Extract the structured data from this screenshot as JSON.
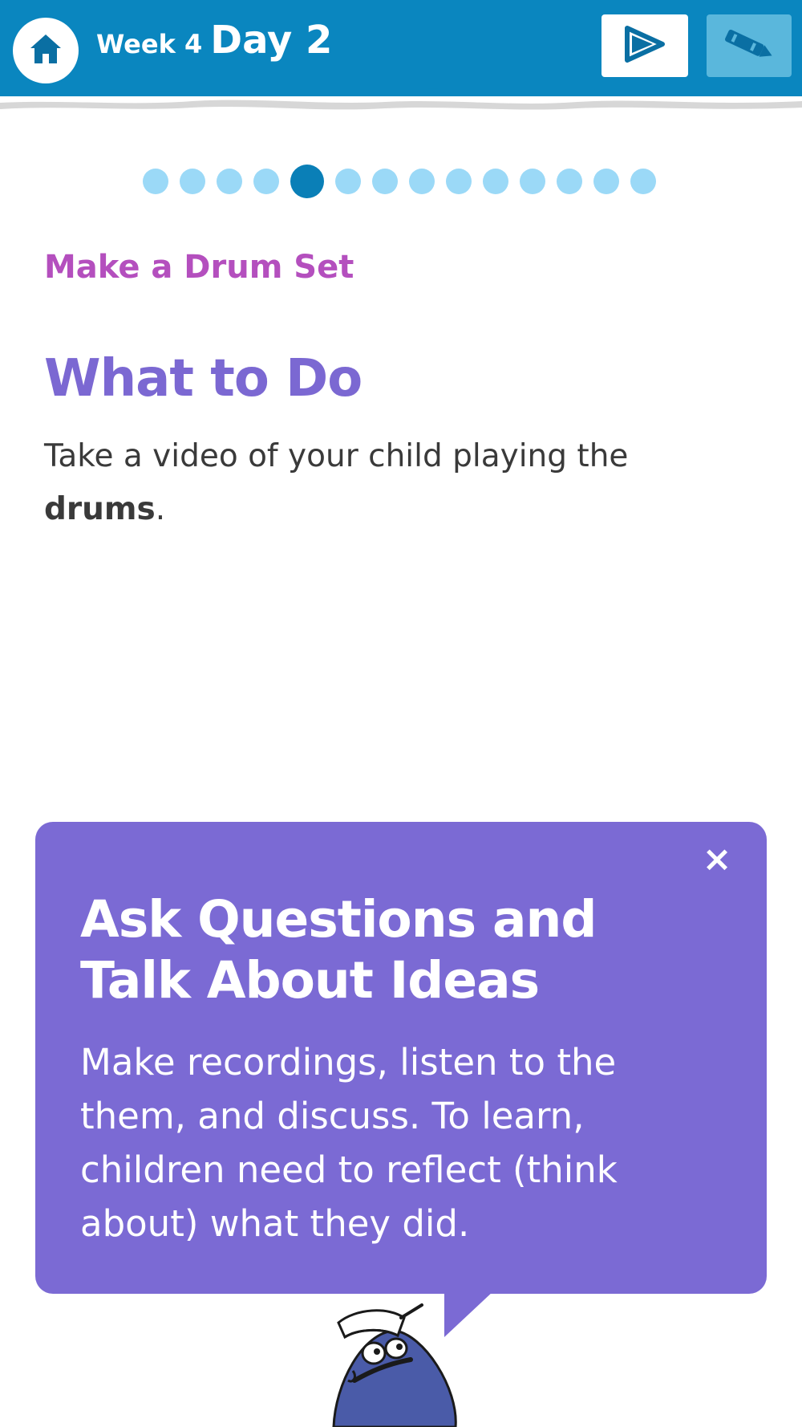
{
  "header": {
    "week_label": "Week 4",
    "day_label": "Day 2",
    "icons": {
      "home": "home-icon",
      "play": "play-icon",
      "crayon": "crayon-icon"
    },
    "colors": {
      "bar": "#0a86bf",
      "crayon_button": "#5ab7dc"
    }
  },
  "progress": {
    "total_steps": 14,
    "current_step": 5,
    "colors": {
      "active": "#0a7fb7",
      "inactive": "#9bd9f7"
    }
  },
  "activity": {
    "title": "Make a Drum Set",
    "section_heading": "What to Do",
    "instruction_prefix": "Take a video of your child playing the ",
    "instruction_bold": "drums",
    "instruction_suffix": "."
  },
  "tip": {
    "close_glyph": "×",
    "title": "Ask Questions and Talk About Ideas",
    "body": "Make recordings, listen to the them, and discuss. To learn, children need to reflect (think about) what they did.",
    "color": "#7b6ad4"
  },
  "mascot": {
    "icon": "blue-drop-character-icon"
  }
}
